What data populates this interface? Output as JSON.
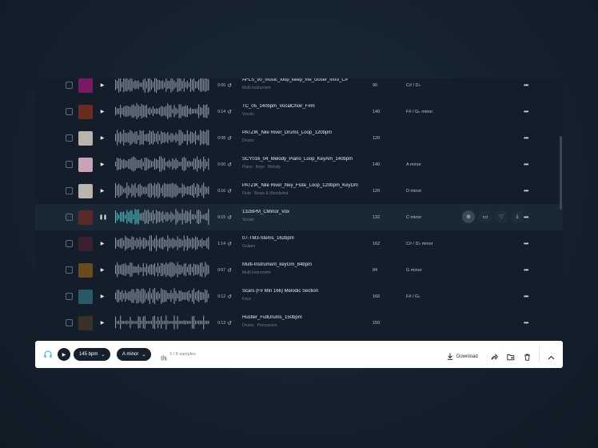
{
  "rows": [
    {
      "title": "AFLS_90_music_loop_keep_me_closer_intro_C#",
      "tags": [
        "Multi Instrument"
      ],
      "duration": "0:00",
      "bpm": "90",
      "key": "C# / D♭",
      "thumb": "#7a1a64",
      "seed": 1
    },
    {
      "title": "TC_05_140bpm_VocalChoir_F#m",
      "tags": [
        "Vocals"
      ],
      "duration": "0:14",
      "bpm": "140",
      "key": "F# / G♭ minor",
      "thumb": "#6a2c1e",
      "seed": 2
    },
    {
      "title": "PATZIK_Nile River_Drums_Loop_120bpm",
      "tags": [
        "Drums"
      ],
      "duration": "0:08",
      "bpm": "120",
      "key": "",
      "thumb": "#b9b4ae",
      "seed": 3
    },
    {
      "title": "SCY016_04_Melody_Piano_Loop_KeyAm_140bpm",
      "tags": [
        "Piano",
        "Keys",
        "Melody"
      ],
      "duration": "0:00",
      "bpm": "140",
      "key": "A minor",
      "thumb": "#c7a3b5",
      "seed": 4
    },
    {
      "title": "PATZIK_Nile River_Ney_Flute_Loop_120bpm_KeyDm",
      "tags": [
        "Flute",
        "Brass & Woodwind"
      ],
      "duration": "0:16",
      "bpm": "120",
      "key": "D minor",
      "thumb": "#b9b4ae",
      "seed": 5
    },
    {
      "title": "132BPM_CMinor_Vox",
      "tags": [
        "Vocals"
      ],
      "duration": "0:15",
      "bpm": "132",
      "key": "C minor",
      "thumb": "#5a2a2a",
      "seed": 6,
      "active": true
    },
    {
      "title": "07-TM3-Stems_162bpm",
      "tags": [
        "Guitars"
      ],
      "duration": "1:14",
      "bpm": "162",
      "key": "C# / D♭ minor",
      "thumb": "#3a2030",
      "seed": 7
    },
    {
      "title": "Multi-Instrument_keyGm_84bpm",
      "tags": [
        "Multi Instrument"
      ],
      "duration": "0:57",
      "bpm": "84",
      "key": "G minor",
      "thumb": "#6b4a1e",
      "seed": 8
    },
    {
      "title": "Scars (F# Min 166) Melodic Section",
      "tags": [
        "Keys"
      ],
      "duration": "0:12",
      "bpm": "166",
      "key": "F# / G♭",
      "thumb": "#2a5a6a",
      "seed": 9
    },
    {
      "title": "Hustler_FullDrums_150bpm",
      "tags": [
        "Drums",
        "Percussion"
      ],
      "duration": "0:13",
      "bpm": "150",
      "key": "",
      "thumb": "#3a3226",
      "seed": 10
    }
  ],
  "player": {
    "bpm_label": "145 bpm",
    "key_label": "A minor",
    "samples_label": "3 / 8 samples",
    "download_label": "Download"
  },
  "colors": {
    "accent": "#4fc3c9",
    "wave": "#8e99a4",
    "wave_played": "#4fc3c9"
  },
  "progress": 0.27
}
